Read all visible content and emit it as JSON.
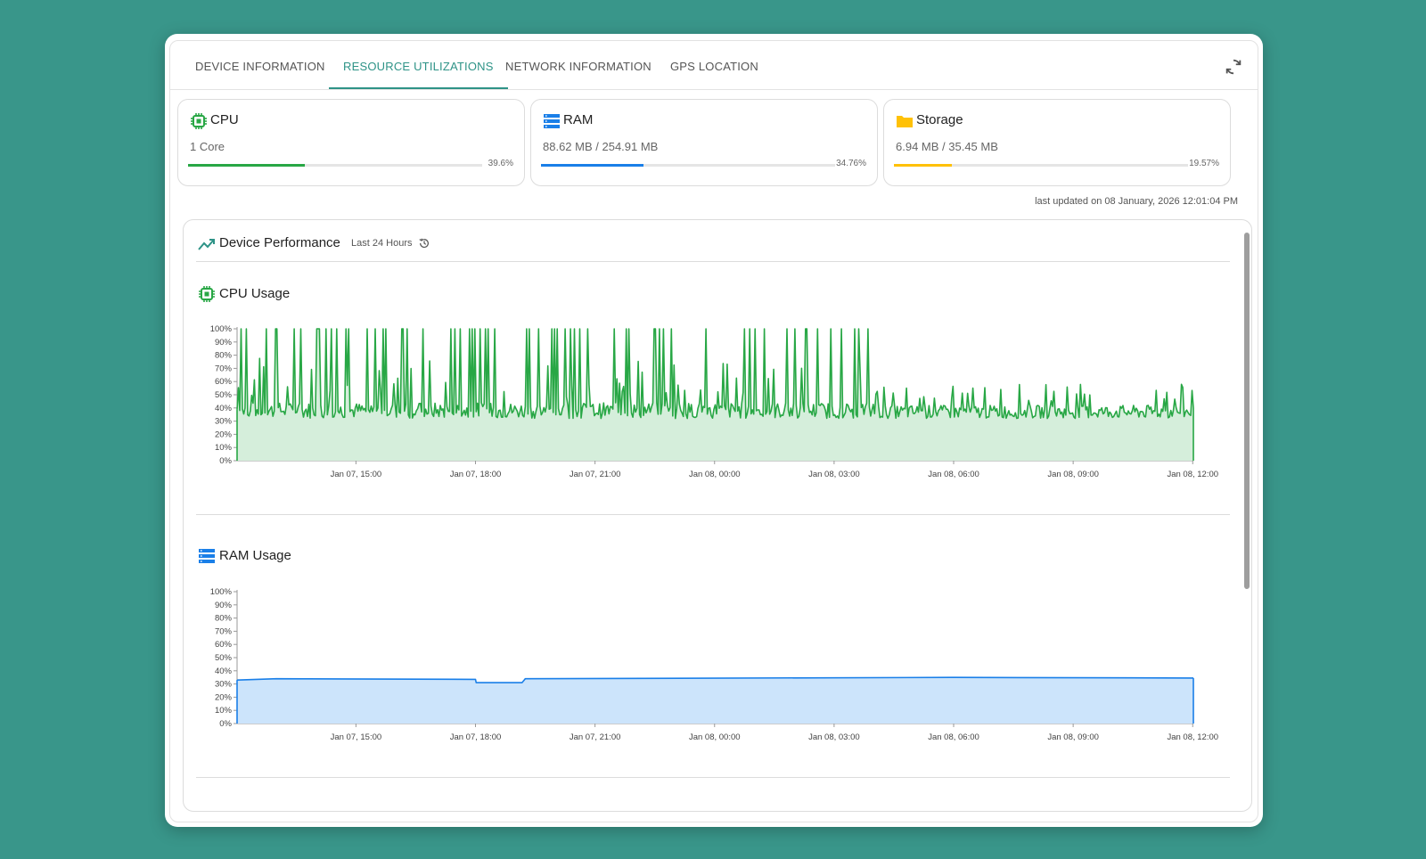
{
  "tabs": [
    {
      "label": "DEVICE INFORMATION",
      "active": false
    },
    {
      "label": "RESOURCE UTILIZATIONS",
      "active": true
    },
    {
      "label": "NETWORK INFORMATION",
      "active": false
    },
    {
      "label": "GPS LOCATION",
      "active": false
    }
  ],
  "refresh_icon": "refresh-icon",
  "cards": {
    "cpu": {
      "title": "CPU",
      "subtitle": "1 Core",
      "percent_label": "39.6%",
      "percent": 39.6,
      "color": "#28a745",
      "icon": "cpu-chip-icon"
    },
    "ram": {
      "title": "RAM",
      "subtitle": "88.62 MB / 254.91 MB",
      "percent_label": "34.76%",
      "percent": 34.76,
      "color": "#1a7fe8",
      "icon": "memory-icon"
    },
    "storage": {
      "title": "Storage",
      "subtitle": "6.94 MB / 35.45 MB",
      "percent_label": "19.57%",
      "percent": 19.57,
      "color": "#ffc107",
      "icon": "folder-icon"
    }
  },
  "last_updated": "last updated on 08 January, 2026 12:01:04 PM",
  "performance": {
    "title": "Device Performance",
    "range": "Last 24 Hours",
    "range_icon": "history-icon",
    "title_icon": "trend-line-icon"
  },
  "chart_data": [
    {
      "type": "area",
      "title": "CPU Usage",
      "y_ticks": [
        "100%",
        "90%",
        "80%",
        "70%",
        "60%",
        "50%",
        "40%",
        "30%",
        "20%",
        "10%",
        "0%"
      ],
      "x_ticks": [
        "Jan 07, 15:00",
        "Jan 07, 18:00",
        "Jan 07, 21:00",
        "Jan 08, 00:00",
        "Jan 08, 03:00",
        "Jan 08, 06:00",
        "Jan 08, 09:00",
        "Jan 08, 12:00"
      ],
      "xlim": [
        "Jan 07, 12:01",
        "Jan 08, 12:01"
      ],
      "ylim": [
        0,
        100
      ],
      "color": "#28a745",
      "fill": "#d5eedb",
      "series": [
        {
          "baseline_until_spikes_end": 38,
          "spike_peak": 100,
          "spikes_end_at": "Jan 08, 04:00",
          "baseline_after": 37,
          "spike_peak_after": 58
        }
      ]
    },
    {
      "type": "area",
      "title": "RAM Usage",
      "y_ticks": [
        "100%",
        "90%",
        "80%",
        "70%",
        "60%",
        "50%",
        "40%",
        "30%",
        "20%",
        "10%",
        "0%"
      ],
      "x_ticks": [
        "Jan 07, 15:00",
        "Jan 07, 18:00",
        "Jan 07, 21:00",
        "Jan 08, 00:00",
        "Jan 08, 03:00",
        "Jan 08, 06:00",
        "Jan 08, 09:00",
        "Jan 08, 12:00"
      ],
      "xlim": [
        "Jan 07, 12:01",
        "Jan 08, 12:01"
      ],
      "ylim": [
        0,
        100
      ],
      "color": "#1a7fe8",
      "fill": "#cce4fb",
      "series": [
        {
          "x": [
            "Jan 07, 12:01",
            "Jan 07, 13:00",
            "Jan 07, 18:00",
            "Jan 07, 18:01",
            "Jan 07, 19:10",
            "Jan 07, 19:15",
            "Jan 08, 06:00",
            "Jan 08, 12:01"
          ],
          "values": [
            33,
            34,
            33.5,
            31,
            31,
            34,
            35,
            34.5
          ]
        }
      ]
    }
  ]
}
